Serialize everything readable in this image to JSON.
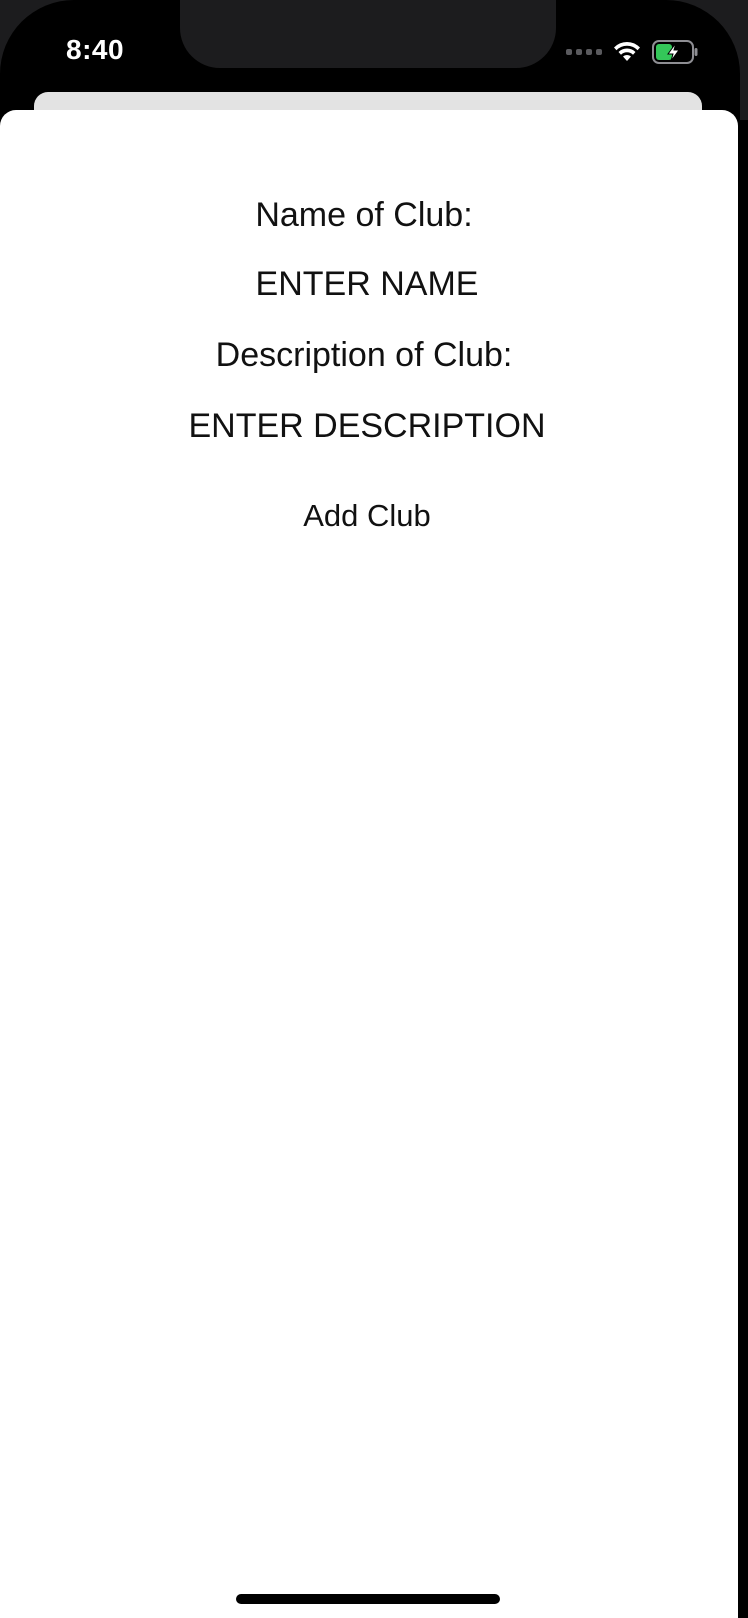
{
  "status_bar": {
    "time": "8:40",
    "icons": [
      "cellular-signal-icon",
      "wifi-icon",
      "battery-charging-icon"
    ],
    "battery_color": "#34c759"
  },
  "form": {
    "name_label": "Name of Club:",
    "name_placeholder": "ENTER NAME",
    "description_label": "Description of Club:",
    "description_placeholder": "ENTER DESCRIPTION",
    "add_button_label": "Add Club"
  }
}
